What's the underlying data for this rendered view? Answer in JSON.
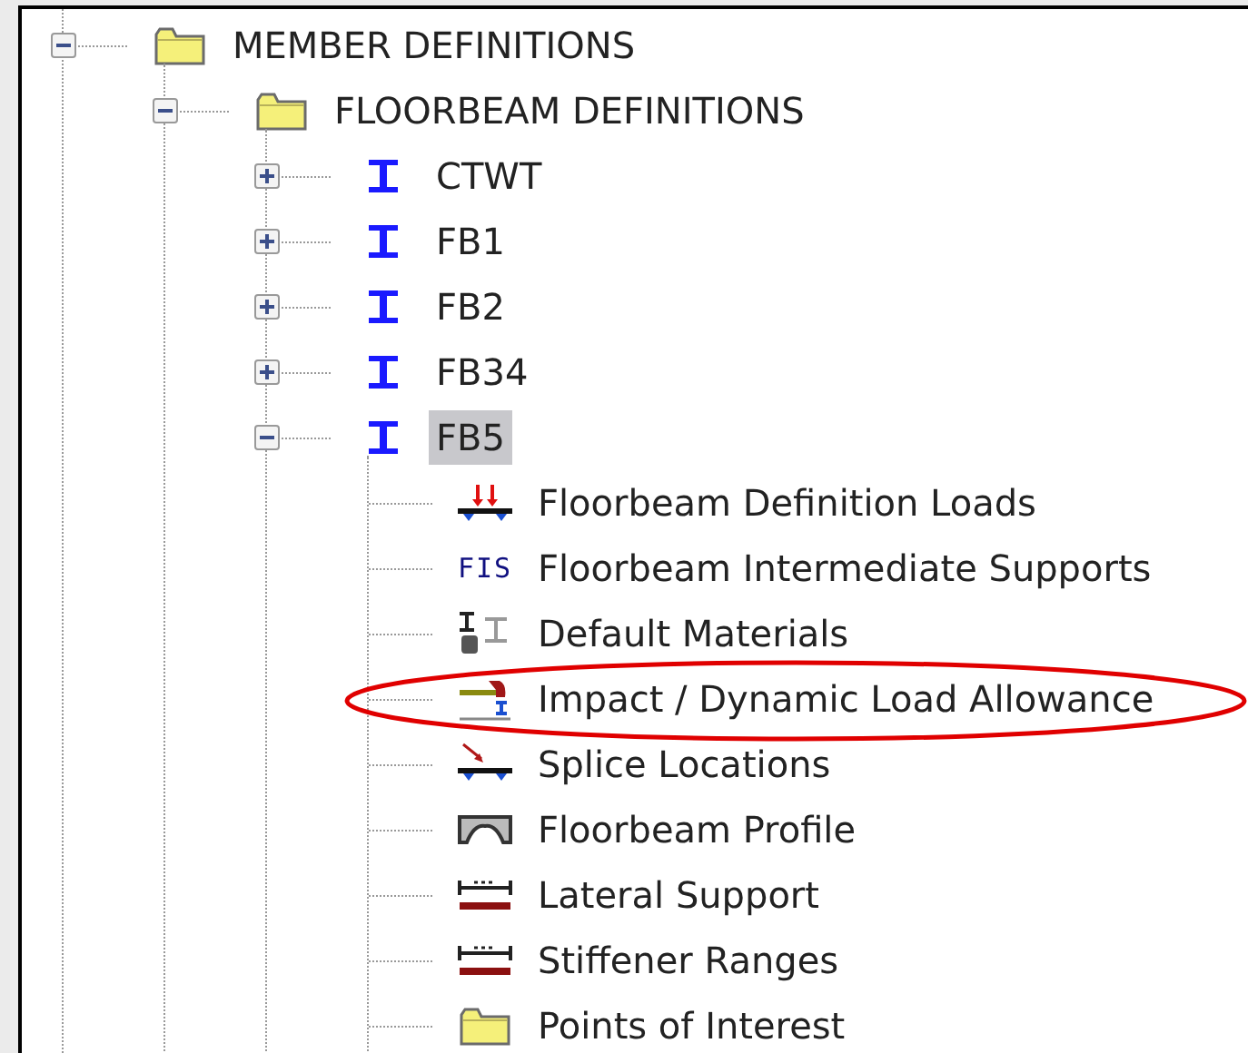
{
  "tree": [
    {
      "label": "MEMBER DEFINITIONS",
      "kind": "folder",
      "expanded": true,
      "selected": false,
      "children": [
        {
          "label": "FLOORBEAM DEFINITIONS",
          "kind": "folder",
          "expanded": true,
          "selected": false,
          "children": [
            {
              "label": "CTWT",
              "kind": "beam",
              "expanded": false,
              "selected": false
            },
            {
              "label": "FB1",
              "kind": "beam",
              "expanded": false,
              "selected": false
            },
            {
              "label": "FB2",
              "kind": "beam",
              "expanded": false,
              "selected": false
            },
            {
              "label": "FB34",
              "kind": "beam",
              "expanded": false,
              "selected": false
            },
            {
              "label": "FB5",
              "kind": "beam",
              "expanded": true,
              "selected": true,
              "children": [
                {
                  "label": "Floorbeam Definition Loads",
                  "kind": "loads",
                  "selected": false
                },
                {
                  "label": "Floorbeam Intermediate Supports",
                  "kind": "fis",
                  "icon_text": "FIS",
                  "selected": false
                },
                {
                  "label": "Default Materials",
                  "kind": "materials",
                  "selected": false
                },
                {
                  "label": "Impact / Dynamic Load Allowance",
                  "kind": "impact",
                  "selected": false
                },
                {
                  "label": "Splice Locations",
                  "kind": "splice",
                  "selected": false
                },
                {
                  "label": "Floorbeam Profile",
                  "kind": "profile",
                  "selected": false
                },
                {
                  "label": "Lateral Support",
                  "kind": "range",
                  "selected": false
                },
                {
                  "label": "Stiffener Ranges",
                  "kind": "range",
                  "selected": false
                },
                {
                  "label": "Points of Interest",
                  "kind": "folder",
                  "selected": false
                }
              ]
            }
          ]
        }
      ]
    }
  ]
}
